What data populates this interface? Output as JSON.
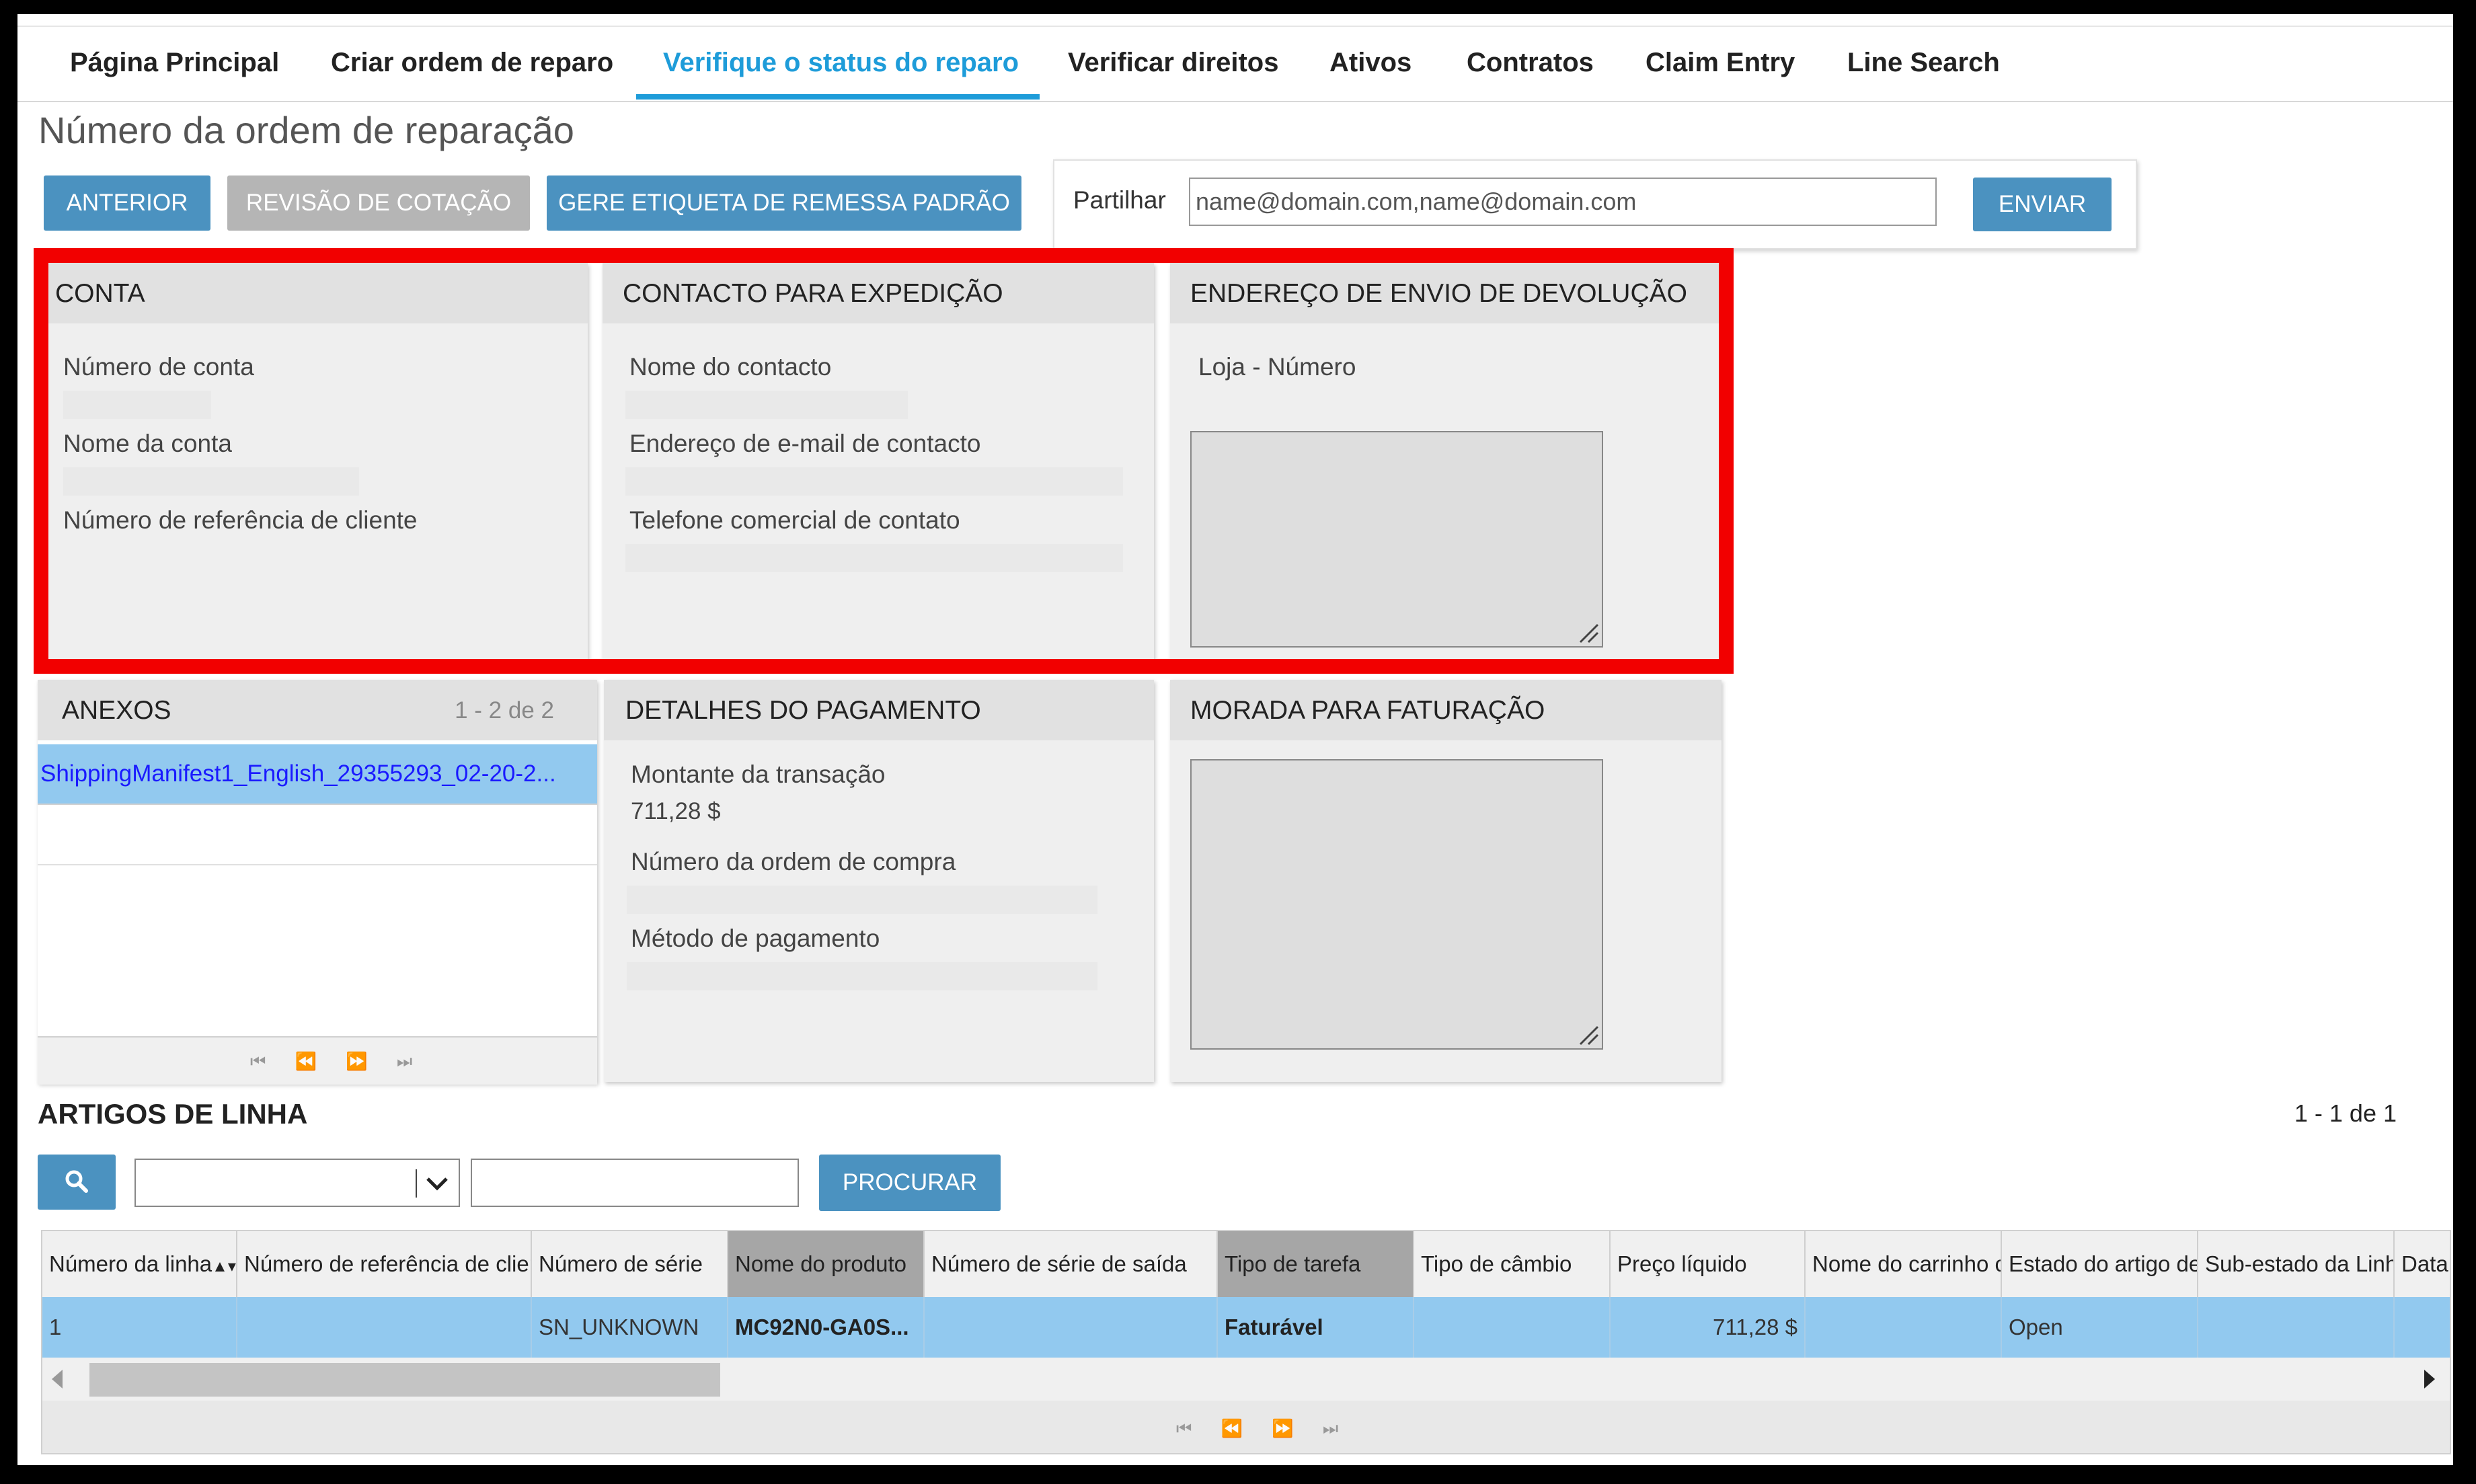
{
  "nav": {
    "items": [
      "Página Principal",
      "Criar ordem de reparo",
      "Verifique o status do reparo",
      "Verificar direitos",
      "Ativos",
      "Contratos",
      "Claim Entry",
      "Line Search"
    ],
    "active_index": 2
  },
  "page_title": "Número da ordem de reparação",
  "buttons": {
    "back": "ANTERIOR",
    "quote_review": "REVISÃO DE COTAÇÃO",
    "shipping_label": "GERE ETIQUETA DE REMESSA PADRÃO",
    "send": "ENVIAR",
    "search": "PROCURAR"
  },
  "share": {
    "label": "Partilhar",
    "value": "name@domain.com,name@domain.com"
  },
  "account": {
    "title": "CONTA",
    "fields": [
      "Número de conta",
      "Nome da conta",
      "Número de referência de cliente"
    ]
  },
  "shipping_contact": {
    "title": "CONTACTO PARA EXPEDIÇÃO",
    "fields": [
      "Nome do contacto",
      "Endereço de e-mail de contacto",
      "Telefone comercial de contato"
    ]
  },
  "return_address": {
    "title": "ENDEREÇO DE ENVIO DE DEVOLUÇÃO",
    "store_label": "Loja - Número"
  },
  "attachments": {
    "title": "ANEXOS",
    "count": "1 - 2 de 2",
    "items": [
      "ShippingManifest1_English_29355293_02-20-2..."
    ]
  },
  "payment": {
    "title": "DETALHES DO PAGAMENTO",
    "amount_label": "Montante da transação",
    "amount_value": "711,28 $",
    "po_label": "Número da ordem de compra",
    "method_label": "Método de pagamento"
  },
  "billing_address": {
    "title": "MORADA PARA FATURAÇÃO"
  },
  "line_items": {
    "title": "ARTIGOS DE LINHA",
    "count": "1 - 1 de 1",
    "columns": [
      "Número da linha",
      "Número de referência de clier",
      "Número de série",
      "Nome do produto",
      "Número de série de saída",
      "Tipo de tarefa",
      "Tipo de câmbio",
      "Preço líquido",
      "Nome do carrinho c",
      "Estado do artigo de",
      "Sub-estado da Linh",
      "Data"
    ],
    "rows": [
      [
        "1",
        "",
        "SN_UNKNOWN",
        "MC92N0-GA0S...",
        "",
        "Faturável",
        "",
        "711,28 $",
        "",
        "Open",
        "",
        ""
      ]
    ]
  },
  "colors": {
    "accent": "#1e9cd9",
    "button": "#4b92c0",
    "button_disabled": "#b5b5b5",
    "highlight": "#f20000",
    "selected_row": "#92c9ef"
  }
}
